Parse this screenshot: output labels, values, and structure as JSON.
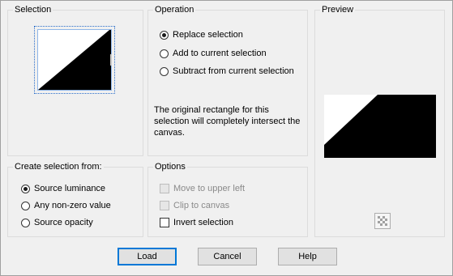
{
  "selection": {
    "title": "Selection"
  },
  "operation": {
    "title": "Operation",
    "options": [
      "Replace selection",
      "Add to current selection",
      "Subtract from current selection"
    ],
    "selected": 0,
    "description": "The original rectangle for this selection will completely intersect the canvas."
  },
  "preview": {
    "title": "Preview",
    "toggle_icon": "checkerboard-icon"
  },
  "create_from": {
    "title": "Create selection from:",
    "options": [
      "Source luminance",
      "Any non-zero value",
      "Source opacity"
    ],
    "selected": 0
  },
  "options": {
    "title": "Options",
    "items": [
      {
        "label": "Move to upper left",
        "enabled": false,
        "checked": false
      },
      {
        "label": "Clip to canvas",
        "enabled": false,
        "checked": false
      },
      {
        "label": "Invert selection",
        "enabled": true,
        "checked": false
      }
    ]
  },
  "buttons": {
    "load": "Load",
    "cancel": "Cancel",
    "help": "Help"
  },
  "colors": {
    "accent": "#0078d7",
    "group_border": "#dcdcdc",
    "background": "#f0f0f0"
  }
}
